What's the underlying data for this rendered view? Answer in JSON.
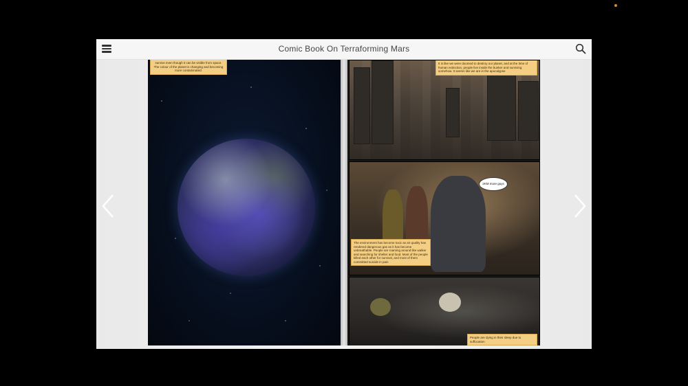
{
  "header": {
    "title": "Comic Book On Terraforming Mars",
    "menu_icon": "hamburger-menu-icon",
    "search_icon": "search-icon"
  },
  "navigation": {
    "prev_icon": "chevron-left-icon",
    "next_icon": "chevron-right-icon"
  },
  "left_page": {
    "caption": "survive even though it can be visible from space. The colour of the planet is changing and becoming more contaminated."
  },
  "right_page": {
    "caption_top": "It is like we were doomed to destroy our planet, and at the time of human extinction, people live inside the bunker and surviving somehow. It seems like we are in the apocalypse",
    "speech_bubble": "2KM more guys",
    "caption_middle": "The environment has become toxic as air quality has rendered dangerous gas as it has become unbreathable. People are roaming around like walker and searching for shelter and food. Most of the people killed each other for survival, and most of them committed suicide in pain",
    "caption_bottom": "People are dying in their sleep due to suffocation"
  },
  "colors": {
    "caption_bg": "#f4cf83",
    "toolbar_bg": "#f6f6f6",
    "indicator_dot": "#d98a2b"
  }
}
